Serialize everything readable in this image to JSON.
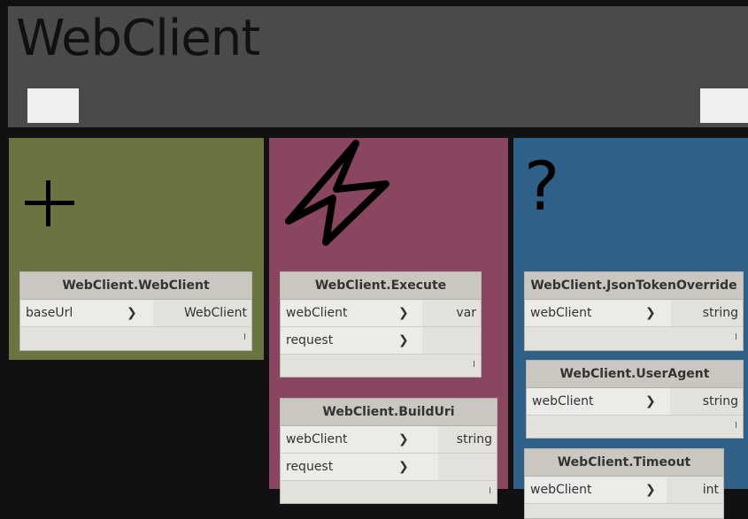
{
  "header": {
    "title": "WebClient"
  },
  "categories": {
    "create": {
      "icon": "plus-icon",
      "color": "#6b7341"
    },
    "action": {
      "icon": "lightning-icon",
      "color": "#8a4660"
    },
    "query": {
      "icon": "question-icon",
      "glyph": "?",
      "color": "#2e6088"
    }
  },
  "nodes": {
    "webclient": {
      "title": "WebClient.WebClient",
      "inputs": [
        "baseUrl"
      ],
      "output": "WebClient",
      "tick": "I"
    },
    "execute": {
      "title": "WebClient.Execute",
      "inputs": [
        "webClient",
        "request"
      ],
      "output": "var",
      "tick": "I"
    },
    "builduri": {
      "title": "WebClient.BuildUri",
      "inputs": [
        "webClient",
        "request"
      ],
      "output": "string",
      "tick": "I"
    },
    "jsontoken": {
      "title": "WebClient.JsonTokenOverride",
      "inputs": [
        "webClient"
      ],
      "output": "string",
      "tick": "I"
    },
    "useragent": {
      "title": "WebClient.UserAgent",
      "inputs": [
        "webClient"
      ],
      "output": "string",
      "tick": "I"
    },
    "timeout": {
      "title": "WebClient.Timeout",
      "inputs": [
        "webClient"
      ],
      "output": "int"
    }
  },
  "arrow_glyph": "❯"
}
